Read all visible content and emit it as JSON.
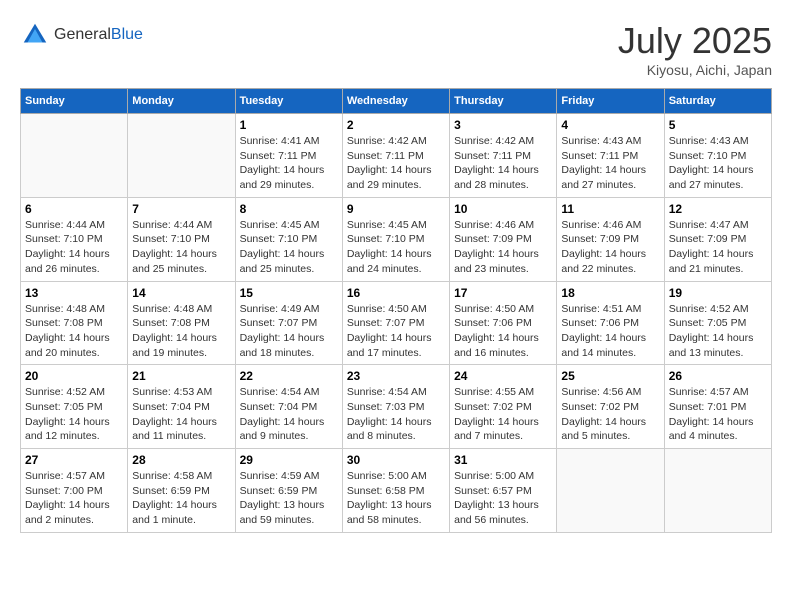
{
  "header": {
    "logo_general": "General",
    "logo_blue": "Blue",
    "month": "July 2025",
    "location": "Kiyosu, Aichi, Japan"
  },
  "weekdays": [
    "Sunday",
    "Monday",
    "Tuesday",
    "Wednesday",
    "Thursday",
    "Friday",
    "Saturday"
  ],
  "weeks": [
    [
      {
        "day": "",
        "info": ""
      },
      {
        "day": "",
        "info": ""
      },
      {
        "day": "1",
        "info": "Sunrise: 4:41 AM\nSunset: 7:11 PM\nDaylight: 14 hours and 29 minutes."
      },
      {
        "day": "2",
        "info": "Sunrise: 4:42 AM\nSunset: 7:11 PM\nDaylight: 14 hours and 29 minutes."
      },
      {
        "day": "3",
        "info": "Sunrise: 4:42 AM\nSunset: 7:11 PM\nDaylight: 14 hours and 28 minutes."
      },
      {
        "day": "4",
        "info": "Sunrise: 4:43 AM\nSunset: 7:11 PM\nDaylight: 14 hours and 27 minutes."
      },
      {
        "day": "5",
        "info": "Sunrise: 4:43 AM\nSunset: 7:10 PM\nDaylight: 14 hours and 27 minutes."
      }
    ],
    [
      {
        "day": "6",
        "info": "Sunrise: 4:44 AM\nSunset: 7:10 PM\nDaylight: 14 hours and 26 minutes."
      },
      {
        "day": "7",
        "info": "Sunrise: 4:44 AM\nSunset: 7:10 PM\nDaylight: 14 hours and 25 minutes."
      },
      {
        "day": "8",
        "info": "Sunrise: 4:45 AM\nSunset: 7:10 PM\nDaylight: 14 hours and 25 minutes."
      },
      {
        "day": "9",
        "info": "Sunrise: 4:45 AM\nSunset: 7:10 PM\nDaylight: 14 hours and 24 minutes."
      },
      {
        "day": "10",
        "info": "Sunrise: 4:46 AM\nSunset: 7:09 PM\nDaylight: 14 hours and 23 minutes."
      },
      {
        "day": "11",
        "info": "Sunrise: 4:46 AM\nSunset: 7:09 PM\nDaylight: 14 hours and 22 minutes."
      },
      {
        "day": "12",
        "info": "Sunrise: 4:47 AM\nSunset: 7:09 PM\nDaylight: 14 hours and 21 minutes."
      }
    ],
    [
      {
        "day": "13",
        "info": "Sunrise: 4:48 AM\nSunset: 7:08 PM\nDaylight: 14 hours and 20 minutes."
      },
      {
        "day": "14",
        "info": "Sunrise: 4:48 AM\nSunset: 7:08 PM\nDaylight: 14 hours and 19 minutes."
      },
      {
        "day": "15",
        "info": "Sunrise: 4:49 AM\nSunset: 7:07 PM\nDaylight: 14 hours and 18 minutes."
      },
      {
        "day": "16",
        "info": "Sunrise: 4:50 AM\nSunset: 7:07 PM\nDaylight: 14 hours and 17 minutes."
      },
      {
        "day": "17",
        "info": "Sunrise: 4:50 AM\nSunset: 7:06 PM\nDaylight: 14 hours and 16 minutes."
      },
      {
        "day": "18",
        "info": "Sunrise: 4:51 AM\nSunset: 7:06 PM\nDaylight: 14 hours and 14 minutes."
      },
      {
        "day": "19",
        "info": "Sunrise: 4:52 AM\nSunset: 7:05 PM\nDaylight: 14 hours and 13 minutes."
      }
    ],
    [
      {
        "day": "20",
        "info": "Sunrise: 4:52 AM\nSunset: 7:05 PM\nDaylight: 14 hours and 12 minutes."
      },
      {
        "day": "21",
        "info": "Sunrise: 4:53 AM\nSunset: 7:04 PM\nDaylight: 14 hours and 11 minutes."
      },
      {
        "day": "22",
        "info": "Sunrise: 4:54 AM\nSunset: 7:04 PM\nDaylight: 14 hours and 9 minutes."
      },
      {
        "day": "23",
        "info": "Sunrise: 4:54 AM\nSunset: 7:03 PM\nDaylight: 14 hours and 8 minutes."
      },
      {
        "day": "24",
        "info": "Sunrise: 4:55 AM\nSunset: 7:02 PM\nDaylight: 14 hours and 7 minutes."
      },
      {
        "day": "25",
        "info": "Sunrise: 4:56 AM\nSunset: 7:02 PM\nDaylight: 14 hours and 5 minutes."
      },
      {
        "day": "26",
        "info": "Sunrise: 4:57 AM\nSunset: 7:01 PM\nDaylight: 14 hours and 4 minutes."
      }
    ],
    [
      {
        "day": "27",
        "info": "Sunrise: 4:57 AM\nSunset: 7:00 PM\nDaylight: 14 hours and 2 minutes."
      },
      {
        "day": "28",
        "info": "Sunrise: 4:58 AM\nSunset: 6:59 PM\nDaylight: 14 hours and 1 minute."
      },
      {
        "day": "29",
        "info": "Sunrise: 4:59 AM\nSunset: 6:59 PM\nDaylight: 13 hours and 59 minutes."
      },
      {
        "day": "30",
        "info": "Sunrise: 5:00 AM\nSunset: 6:58 PM\nDaylight: 13 hours and 58 minutes."
      },
      {
        "day": "31",
        "info": "Sunrise: 5:00 AM\nSunset: 6:57 PM\nDaylight: 13 hours and 56 minutes."
      },
      {
        "day": "",
        "info": ""
      },
      {
        "day": "",
        "info": ""
      }
    ]
  ]
}
